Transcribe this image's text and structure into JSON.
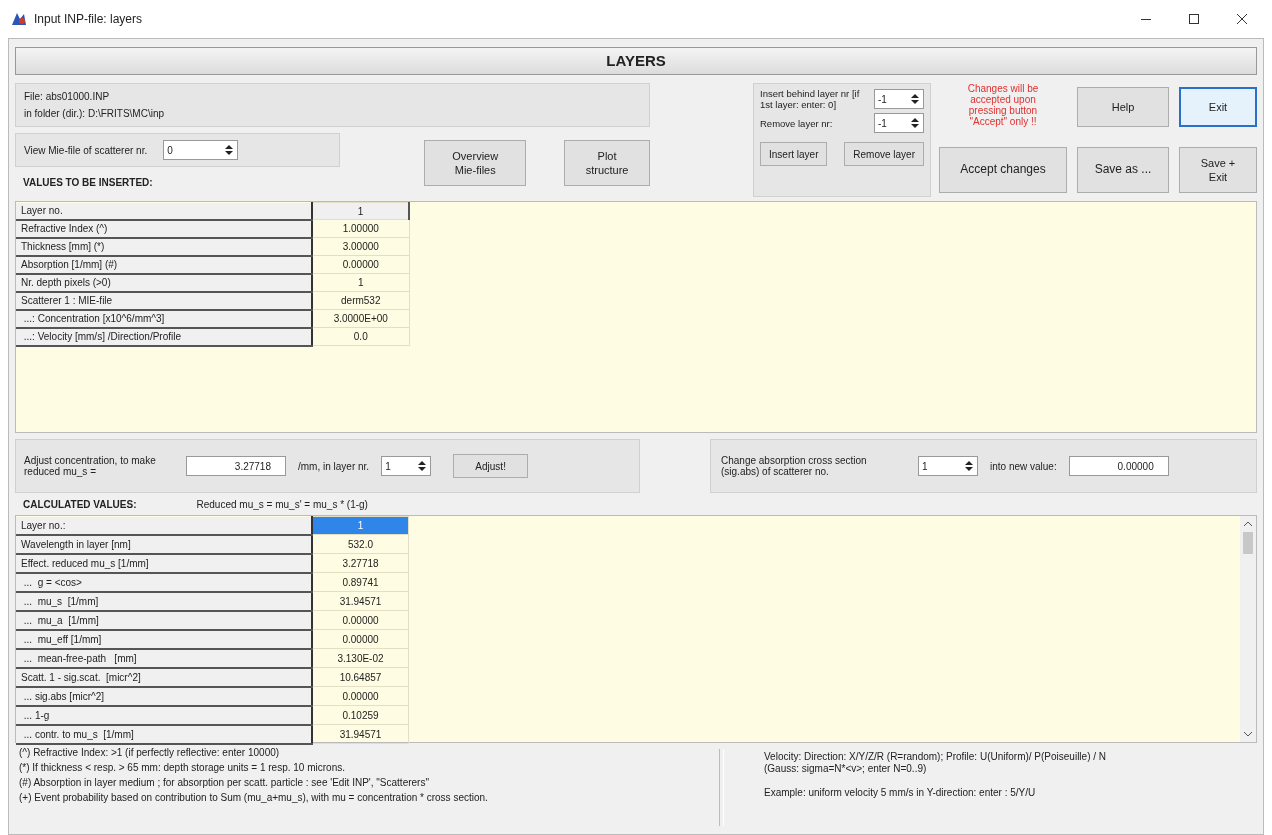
{
  "window": {
    "title": "Input INP-file: layers"
  },
  "header": "LAYERS",
  "file_info": {
    "file": "File:  abs01000.INP",
    "folder": "in folder (dir.): D:\\FRITS\\MC\\inp"
  },
  "mie_view": {
    "label": "View Mie-file of scatterer nr.",
    "value": "0"
  },
  "overview_button": "Overview\nMie-files",
  "plot_button": "Plot\nstructure",
  "values_heading": "VALUES TO BE INSERTED:",
  "insert_panel": {
    "insert_label": "Insert behind layer nr  [if 1st layer: enter: 0]",
    "insert_value": "-1",
    "remove_label": "Remove layer nr:",
    "remove_value": "-1",
    "insert_button": "Insert layer",
    "remove_button": "Remove layer"
  },
  "warning": "Changes will be accepted upon pressing button \"Accept\" only !!",
  "buttons": [
    {
      "label": "Help",
      "kind": "normal"
    },
    {
      "label": "Exit",
      "kind": "default"
    },
    {
      "label": "Accept changes",
      "kind": "normal"
    },
    {
      "label": "Save as ...",
      "kind": "normal"
    },
    {
      "label": "Save  +\nExit",
      "kind": "normal"
    }
  ],
  "values_table": [
    {
      "label": "Layer no.",
      "value": "1",
      "kind": "header"
    },
    {
      "label": "Refractive Index (^)",
      "value": "1.00000",
      "kind": "cell"
    },
    {
      "label": "Thickness [mm] (*)",
      "value": "3.00000",
      "kind": "cell"
    },
    {
      "label": "Absorption [1/mm] (#)",
      "value": "0.00000",
      "kind": "cell"
    },
    {
      "label": "Nr. depth pixels (>0)",
      "value": "1",
      "kind": "cell"
    },
    {
      "label": "Scatterer 1 : MIE-file",
      "value": "derm532",
      "kind": "cell"
    },
    {
      "label": " ...: Concentration [x10^6/mm^3]",
      "value": "3.0000E+00",
      "kind": "cell"
    },
    {
      "label": " ...: Velocity [mm/s] /Direction/Profile",
      "value": "0.0",
      "kind": "cell"
    }
  ],
  "adjust": {
    "label": "Adjust concentration,  to make reduced mu_s =",
    "value": "3.27718",
    "unit_label": "/mm, in layer nr.",
    "layer": "1",
    "button": "Adjust!"
  },
  "absorption": {
    "label": "Change absorption cross section (sig.abs) of scatterer no.",
    "scatterer": "1",
    "into_label": "into new value:",
    "value": "0.00000"
  },
  "calculated": {
    "heading": "CALCULATED VALUES:",
    "formula": "Reduced mu_s = mu_s' = mu_s * (1-g)",
    "rows": [
      {
        "label": "Layer no.:",
        "value": "1",
        "selected": true
      },
      {
        "label": "Wavelength in layer [nm]",
        "value": "532.0",
        "selected": false
      },
      {
        "label": "Effect. reduced mu_s [1/mm]",
        "value": "3.27718",
        "selected": false
      },
      {
        "label": " ...  g = <cos>",
        "value": "0.89741",
        "selected": false
      },
      {
        "label": " ...  mu_s  [1/mm]",
        "value": "31.94571",
        "selected": false
      },
      {
        "label": " ...  mu_a  [1/mm]",
        "value": "0.00000",
        "selected": false
      },
      {
        "label": " ...  mu_eff [1/mm]",
        "value": "0.00000",
        "selected": false
      },
      {
        "label": " ...  mean-free-path   [mm]",
        "value": "3.130E-02",
        "selected": false
      },
      {
        "label": "Scatt. 1 - sig.scat.  [micr^2]",
        "value": "10.64857",
        "selected": false
      },
      {
        "label": " ... sig.abs [micr^2]",
        "value": "0.00000",
        "selected": false
      },
      {
        "label": " ... 1-g",
        "value": "0.10259",
        "selected": false
      },
      {
        "label": " ... contr. to mu_s  [1/mm]",
        "value": "31.94571",
        "selected": false
      }
    ]
  },
  "notes_left": [
    "(^) Refractive Index: >1 (if perfectly reflective: enter 10000)",
    "(*) If thickness < resp. > 65 mm: depth storage units = 1 resp. 10 microns.",
    "(#) Absorption in layer medium ; for absorption per scatt. particle : see 'Edit INP', \"Scatterers\"",
    "(+) Event probability based on contribution to Sum (mu_a+mu_s), with mu = concentration * cross section."
  ],
  "notes_right": [
    "Velocity: Direction: X/Y/Z/R (R=random);  Profile: U(Uniform)/ P(Poiseuille) / N",
    "(Gauss: sigma=N*<v>; enter N=0..9)",
    "Example: uniform velocity 5 mm/s in Y-direction: enter : 5/Y/U"
  ]
}
